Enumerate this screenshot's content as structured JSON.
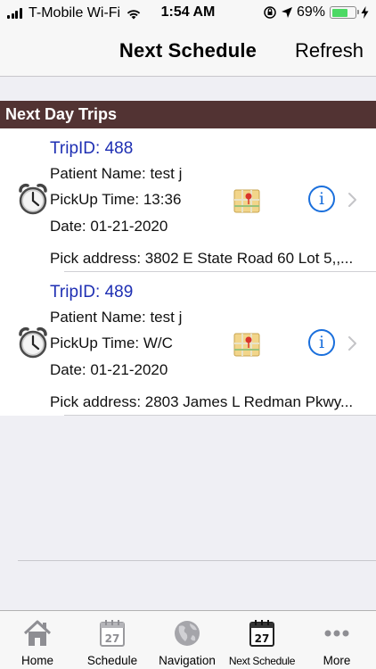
{
  "status": {
    "carrier": "T-Mobile Wi-Fi",
    "time": "1:54 AM",
    "battery": "69%",
    "battery_level": 0.69
  },
  "nav": {
    "title": "Next Schedule",
    "refresh": "Refresh"
  },
  "section": {
    "title": "Next Day Trips"
  },
  "trips": [
    {
      "trip_id": "TripID: 488",
      "patient": "Patient Name: test j",
      "pickup": "PickUp Time: 13:36",
      "date": "Date: 01-21-2020",
      "address": "Pick address: 3802 E State Road 60 Lot 5,,..."
    },
    {
      "trip_id": "TripID: 489",
      "patient": "Patient Name: test j",
      "pickup": "PickUp Time: W/C",
      "date": "Date: 01-21-2020",
      "address": "Pick address: 2803 James L Redman Pkwy..."
    }
  ],
  "tabs": [
    {
      "label": "Home",
      "icon": "home-icon"
    },
    {
      "label": "Schedule",
      "icon": "calendar-icon",
      "day": "27"
    },
    {
      "label": "Navigation",
      "icon": "globe-icon"
    },
    {
      "label": "Next Schedule",
      "icon": "calendar-icon",
      "day": "27"
    },
    {
      "label": "More",
      "icon": "more-dots-icon"
    }
  ],
  "colors": {
    "section_header": "#523333",
    "trip_id": "#1e2fb3",
    "info": "#1a6fdc",
    "battery": "#4cd964"
  },
  "info_glyph": "i"
}
